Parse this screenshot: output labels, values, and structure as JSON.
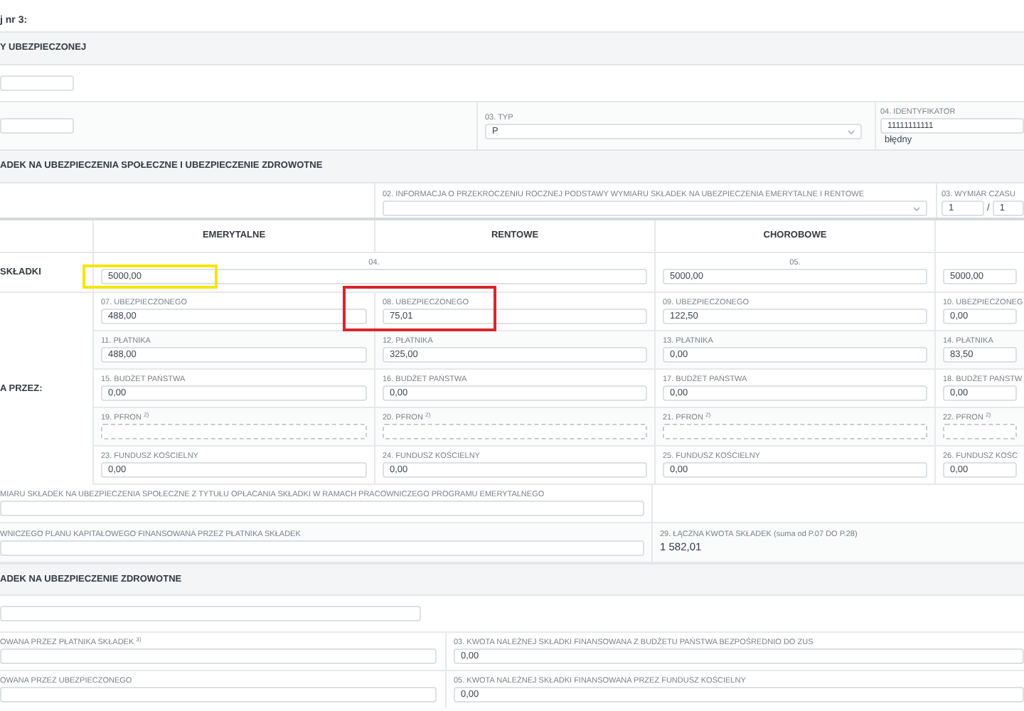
{
  "heading": "j nr 3:",
  "section_1": {
    "title": "Y UBEZPIECZONEJ",
    "typ": {
      "label": "03. TYP",
      "value": "P"
    },
    "identifier": {
      "label": "04. IDENTYFIKATOR",
      "value": "11111111111",
      "note": "błędny"
    }
  },
  "section_2": {
    "title": "ADEK NA UBEZPIECZENIA SPOŁECZNE I UBEZPIECZENIE ZDROWOTNE",
    "limit_info": {
      "label": "02. INFORMACJA O PRZEKROCZENIU ROCZNEJ PODSTAWY WYMIARU SKŁADEK NA UBEZPIECZENIA EMERYTALNE I RENTOWE"
    },
    "working_time": {
      "label": "03. WYMIAR CZASU",
      "numerator": "1",
      "separator": "/",
      "denominator": "1"
    },
    "columns": [
      "EMERYTALNE",
      "RENTOWE",
      "CHOROBOWE"
    ],
    "base_label": "SKŁADKI",
    "base": [
      {
        "label": "04.",
        "value": "5000,00",
        "highlight": {
          "color": "#f5e50a"
        }
      },
      {
        "label": "05.",
        "value": "5000,00"
      },
      {
        "value": "5000,00"
      }
    ],
    "payer_label": "A PRZEZ:",
    "rows": [
      [
        {
          "label": "07. UBEZPIECZONEGO",
          "value": "488,00"
        },
        {
          "label": "08. UBEZPIECZONEGO",
          "value": "75,01",
          "highlight": {
            "color": "#d9262b"
          }
        },
        {
          "label": "09. UBEZPIECZONEGO",
          "value": "122,50"
        },
        {
          "label": "10. UBEZPIECZONEG",
          "value": "0,00"
        }
      ],
      [
        {
          "label": "11. PŁATNIKA",
          "value": "488,00"
        },
        {
          "label": "12. PŁATNIKA",
          "value": "325,00"
        },
        {
          "label": "13. PŁATNIKA",
          "value": "0,00"
        },
        {
          "label": "14. PŁATNIKA",
          "value": "83,50"
        }
      ],
      [
        {
          "label": "15. BUDŻET PAŃSTWA",
          "value": "0,00"
        },
        {
          "label": "16. BUDŻET PAŃSTWA",
          "value": "0,00"
        },
        {
          "label": "17. BUDŻET PAŃSTWA",
          "value": "0,00"
        },
        {
          "label": "18. BUDŻET PAŃSTW",
          "value": "0,00"
        }
      ],
      [
        {
          "label": "19. PFRON $^{2)}$"
        },
        {
          "label": "20. PFRON $^{2)}$"
        },
        {
          "label": "21. PFRON $^{2)}$"
        },
        {
          "label": "22. PFRON $^{2)}$"
        }
      ],
      [
        {
          "label": "23. FUNDUSZ KOŚCIELNY",
          "value": "0,00"
        },
        {
          "label": "24. FUNDUSZ KOŚCIELNY",
          "value": "0,00"
        },
        {
          "label": "25. FUNDUSZ KOŚCIELNY",
          "value": "0,00"
        },
        {
          "label": "26. FUNDUSZ KOŚC",
          "value": "0,00"
        }
      ]
    ],
    "ppe": {
      "label": "MIARU SKŁADEK NA UBEZPIECZENIA SPOŁECZNE Z TYTUŁU OPŁACANIA SKŁADKI W RAMACH PRACOWNICZEGO PROGRAMU EMERYTALNEGO"
    },
    "ppk": {
      "label": "WNICZEGO PLANU KAPITAŁOWEGO FINANSOWANA PRZEZ PŁATNIKA SKŁADEK"
    },
    "total": {
      "label": "29. ŁĄCZNA KWOTA SKŁADEK (suma od P.07 DO P.28)",
      "value": "1 582,01"
    }
  },
  "section_3": {
    "title": "ADEK NA UBEZPIECZENIE ZDROWOTNE",
    "rows": [
      [
        {
          "label": "OWANA PRZEZ PŁATNIKA SKŁADEK $^{3)}$"
        },
        {
          "label": "03. KWOTA NALEŻNEJ SKŁADKI FINANSOWANA Z BUDŻETU PAŃSTWA BEZPOŚREDNIO DO ZUS",
          "value": "0,00"
        }
      ],
      [
        {
          "label": "OWANA PRZEZ UBEZPIECZONEGO"
        },
        {
          "label": "05. KWOTA NALEŻNEJ SKŁADKI FINANSOWANA PRZEZ FUNDUSZ KOŚCIELNY",
          "value": "0,00"
        }
      ]
    ]
  }
}
